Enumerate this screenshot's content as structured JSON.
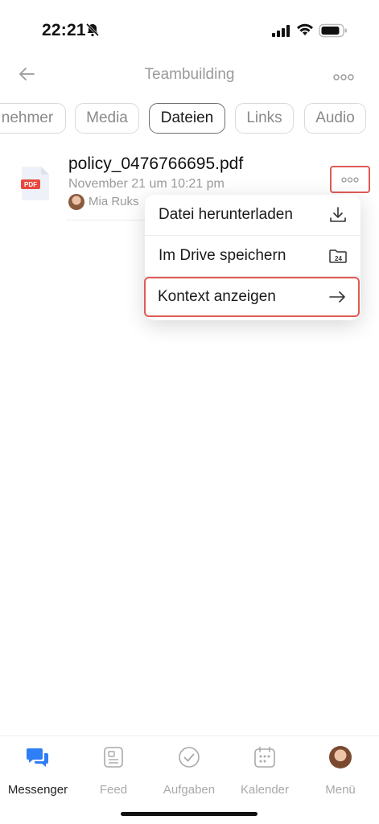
{
  "status": {
    "time": "22:21"
  },
  "header": {
    "title": "Teambuilding"
  },
  "tabs": [
    {
      "label": "nehmer"
    },
    {
      "label": "Media"
    },
    {
      "label": "Dateien"
    },
    {
      "label": "Links"
    },
    {
      "label": "Audio"
    }
  ],
  "file": {
    "name": "policy_0476766695.pdf",
    "date": "November 21 um 10:21 pm",
    "author": "Mia Ruks",
    "badge": "PDF"
  },
  "menu": {
    "items": [
      {
        "label": "Datei herunterladen",
        "icon": "download-icon"
      },
      {
        "label": "Im Drive speichern",
        "icon": "drive-folder-icon"
      },
      {
        "label": "Kontext anzeigen",
        "icon": "arrow-right-icon"
      }
    ],
    "drive_badge": "24"
  },
  "nav": {
    "items": [
      {
        "label": "Messenger",
        "icon": "chat-bubbles-icon"
      },
      {
        "label": "Feed",
        "icon": "feed-icon"
      },
      {
        "label": "Aufgaben",
        "icon": "check-circle-icon"
      },
      {
        "label": "Kalender",
        "icon": "calendar-icon"
      },
      {
        "label": "Menü",
        "icon": "avatar-icon"
      }
    ]
  },
  "colors": {
    "accent": "#2f7ef5",
    "highlight": "#e05a54",
    "muted": "#9a9a9a"
  }
}
